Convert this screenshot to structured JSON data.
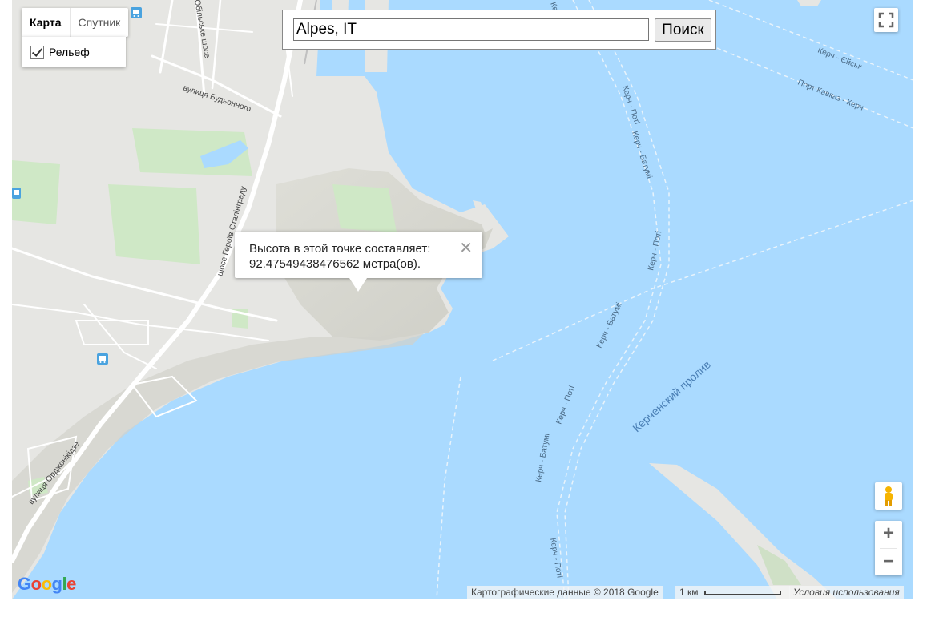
{
  "map_type": {
    "map_label": "Карта",
    "satellite_label": "Спутник",
    "active": "Карта"
  },
  "terrain": {
    "label": "Рельеф",
    "checked": true
  },
  "search": {
    "value": "Alpes, IT",
    "button_label": "Поиск"
  },
  "info_window": {
    "line1": "Высота в этой точке составляет:",
    "line2": "92.47549438476562 метра(ов).",
    "close": "✕"
  },
  "map_labels": {
    "street_budyonnogo": "вулиця Будьонного",
    "highway_heroes": "шосе Героїв Сталінграду",
    "highway_obilske": "Обільське шосе",
    "street_ordzhonikidze": "вулиця Орджонікідзе",
    "strait": "Керченский пролив",
    "ferry_kerch_yeysk_1": "Керч - Єйськ",
    "ferry_kerch_yeysk_2": "Керч - Єйськ",
    "ferry_port_kavkaz": "Порт Кавказ - Керч",
    "ferry_kerch_poti_1": "Керч - Поті",
    "ferry_kerch_batumi_1": "Керч - Батумі",
    "ferry_kerch_poti_2": "Керч - Поті",
    "ferry_kerch_batumi_2": "Керч - Батумі",
    "ferry_kerch_poti_3": "Керч - Поті",
    "ferry_kerch_batumi_3": "Керч - Батумі",
    "ferry_kerch_poti_4": "Керч - Поті"
  },
  "attribution": {
    "data": "Картографические данные © 2018 Google",
    "scale": "1 км",
    "terms": "Условия использования"
  },
  "logo": {
    "letters": [
      "G",
      "o",
      "o",
      "g",
      "l",
      "e"
    ],
    "colors": [
      "#4285f4",
      "#ea4335",
      "#fbbc05",
      "#4285f4",
      "#34a853",
      "#ea4335"
    ]
  },
  "colors": {
    "water": "#aadaff",
    "land": "#e8e8e8",
    "park": "#c8e6c0",
    "road": "#ffffff"
  },
  "icons": {
    "fullscreen": "fullscreen-icon",
    "pegman": "pegman-icon",
    "zoom_in": "plus-icon",
    "zoom_out": "minus-icon",
    "bus": "bus-stop-icon"
  }
}
